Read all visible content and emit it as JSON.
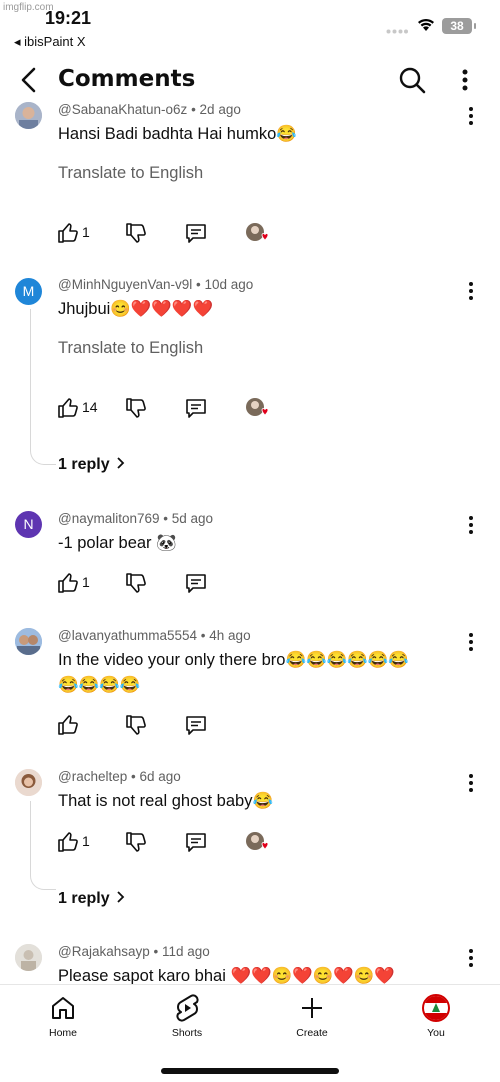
{
  "watermark": "imgflip.com",
  "status": {
    "time": "19:21",
    "back_app": "◂ ibisPaint X",
    "battery": "38"
  },
  "header": {
    "title": "Comments"
  },
  "comments": [
    {
      "handle": "@SabanaKhatun-o6z",
      "age": "2d ago",
      "text": "Hansi Badi badhta Hai humko😂",
      "translate": "Translate to English",
      "likes": "1",
      "creator_hearted": true
    },
    {
      "avatar_letter": "M",
      "avatar_color": "#1f86d8",
      "handle": "@MinhNguyenVan-v9l",
      "age": "10d ago",
      "text": "Jhujbui😊❤️❤️❤️❤️",
      "translate": "Translate to English",
      "likes": "14",
      "creator_hearted": true,
      "replies": "1 reply"
    },
    {
      "avatar_letter": "N",
      "avatar_color": "#5e35b1",
      "handle": "@naymaliton769",
      "age": "5d ago",
      "text": "-1 polar bear 🐼",
      "likes": "1"
    },
    {
      "handle": "@lavanyathumma5554",
      "age": "4h ago",
      "text": "In the video your only there bro😂😂😂😂😂😂",
      "text2": "😂😂😂😂",
      "likes": ""
    },
    {
      "handle": "@racheltep",
      "age": "6d ago",
      "text": "That is not real ghost baby😂",
      "likes": "1",
      "creator_hearted": true,
      "replies": "1 reply"
    },
    {
      "handle": "@Rajakahsayp",
      "age": "11d ago",
      "text": "Please sapot karo bhai ❤️❤️😊❤️😊❤️😊❤️"
    }
  ],
  "nav": {
    "home": "Home",
    "shorts": "Shorts",
    "create": "Create",
    "you": "You"
  },
  "colors": {
    "heart": "#e0001b",
    "muted": "#606060",
    "divider": "#e6e6e6"
  }
}
